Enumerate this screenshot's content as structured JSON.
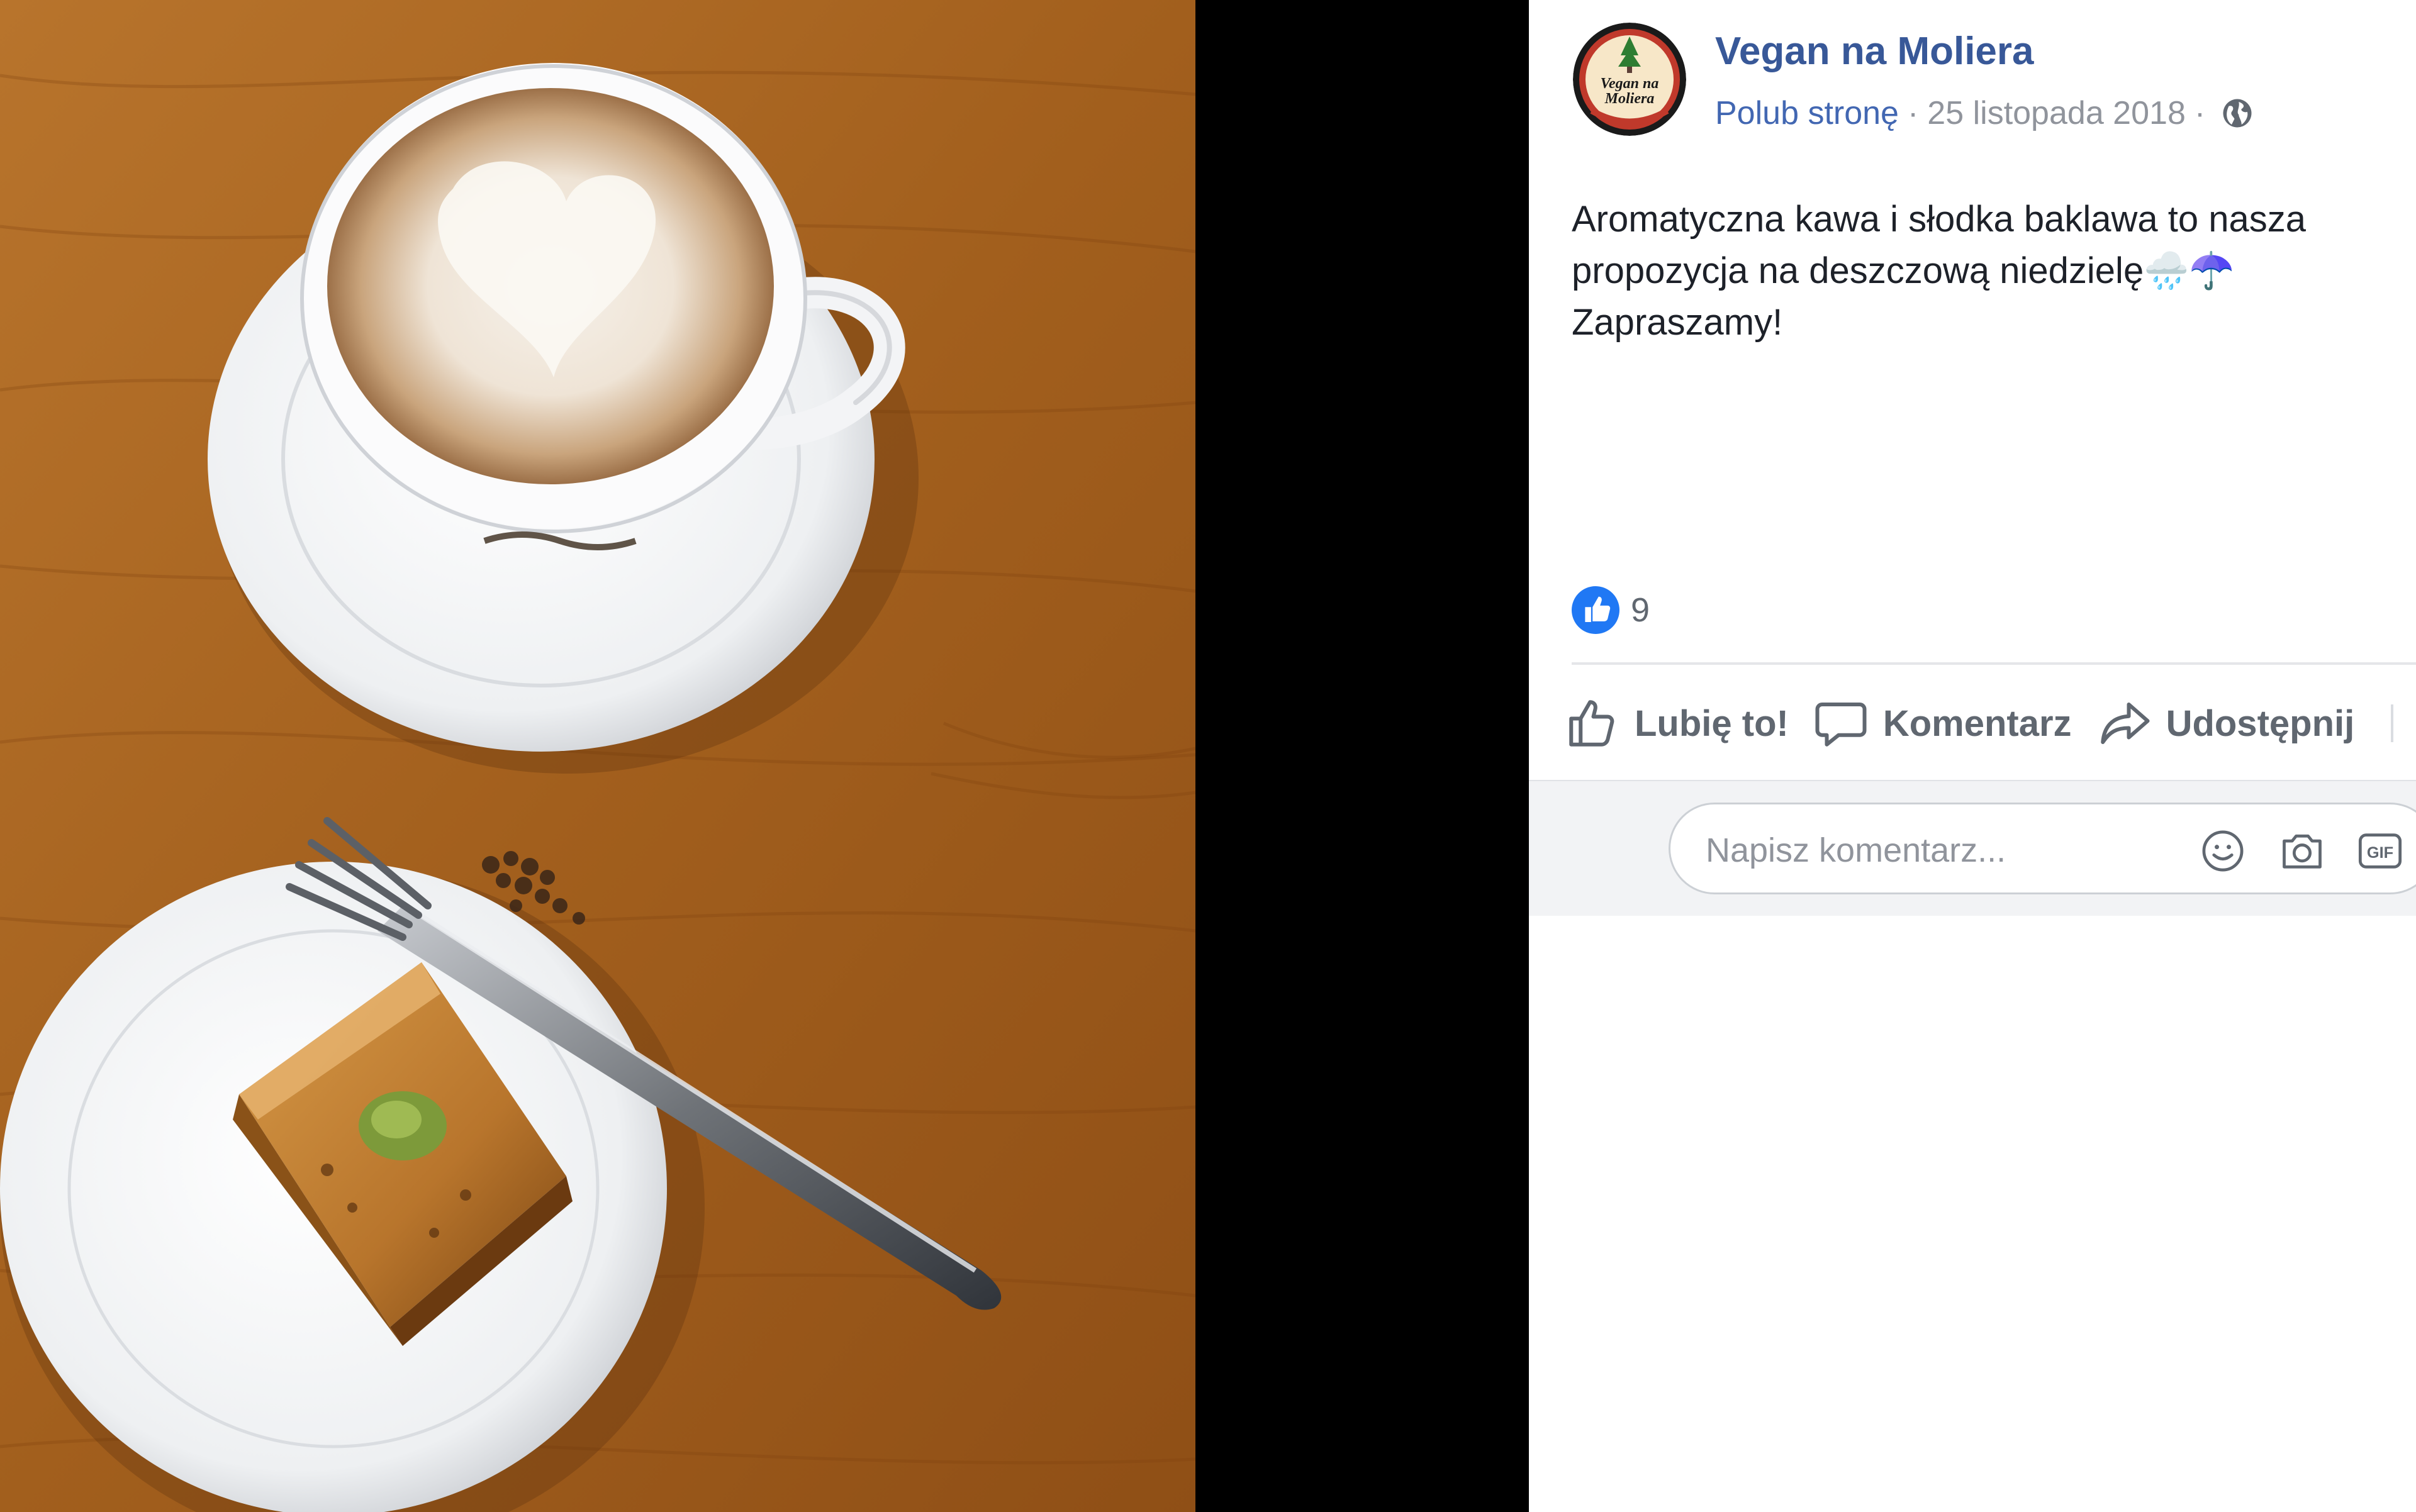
{
  "post": {
    "page_name": "Vegan na Moliera",
    "like_page": "Polub stronę",
    "separator": "·",
    "date": "25 listopada 2018",
    "privacy_icon": "globe-icon",
    "text_lines": [
      "Aromatyczna kawa i słodka baklawa to nasza",
      "propozycja na deszczową niedzielę🌧️☂️",
      "Zapraszamy!"
    ]
  },
  "avatar": {
    "line1": "Vegan na",
    "line2": "Moliera"
  },
  "reactions": {
    "icon": "like-reaction-icon",
    "count": "9"
  },
  "actions": {
    "like": "Lubię to!",
    "comment": "Komentarz",
    "share": "Udostępnij"
  },
  "comment_input": {
    "placeholder": "Napisz komentarz...",
    "icons": [
      "emoji-icon",
      "camera-icon",
      "gif-icon"
    ],
    "gif_label": "GIF"
  },
  "colors": {
    "link": "#385898",
    "like_blue": "#4267b2",
    "meta_gray": "#90949c",
    "text": "#1d2129"
  }
}
